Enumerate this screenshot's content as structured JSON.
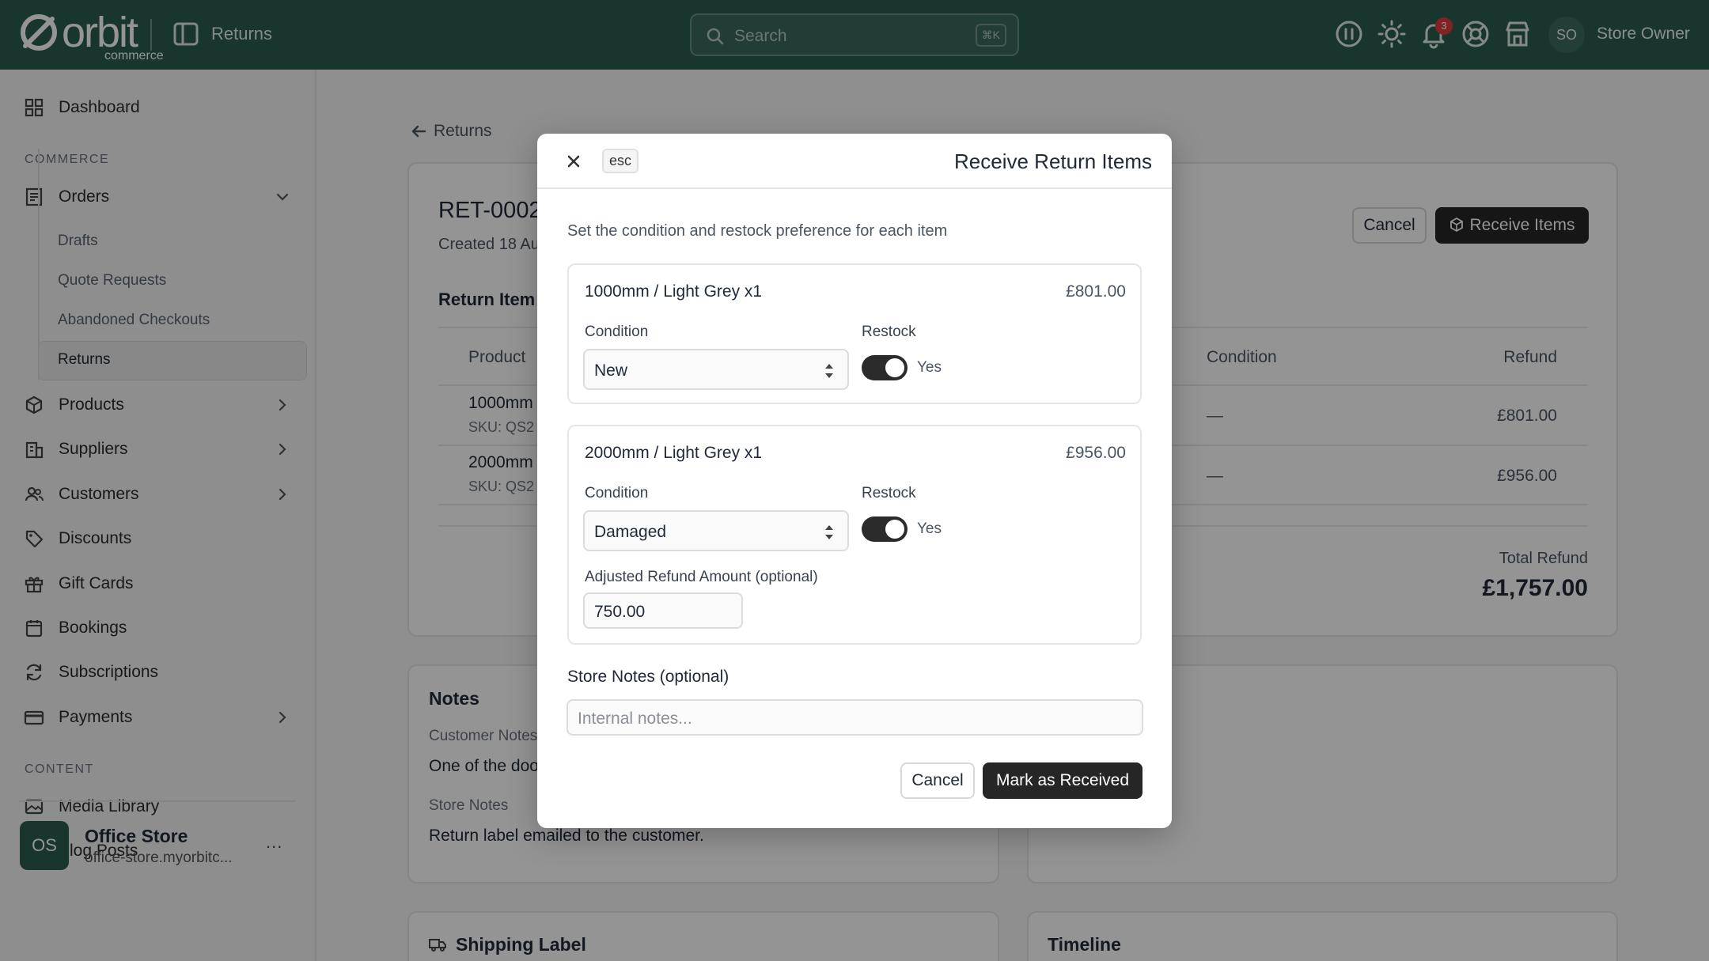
{
  "brand": {
    "name": "orbit",
    "sub": "commerce"
  },
  "header": {
    "page": "Returns",
    "search_placeholder": "Search",
    "search_shortcut": "⌘K",
    "notification_count": "3",
    "user_initials": "SO",
    "user_name": "Store Owner"
  },
  "sidebar": {
    "dashboard": "Dashboard",
    "section_commerce": "COMMERCE",
    "orders": "Orders",
    "orders_sub": [
      "Drafts",
      "Quote Requests",
      "Abandoned Checkouts",
      "Returns"
    ],
    "products": "Products",
    "suppliers": "Suppliers",
    "customers": "Customers",
    "discounts": "Discounts",
    "gift_cards": "Gift Cards",
    "bookings": "Bookings",
    "subscriptions": "Subscriptions",
    "payments": "Payments",
    "section_content": "CONTENT",
    "media_library": "Media Library",
    "blog_posts": "Blog Posts",
    "store": {
      "initials": "OS",
      "name": "Office Store",
      "url": "office-store.myorbitc...",
      "more": "..."
    }
  },
  "page": {
    "back_label": "Returns",
    "return_id": "RET-0002",
    "created": "Created 18 Au",
    "cancel_label": "Cancel",
    "receive_label": "Receive Items",
    "return_items_heading": "Return Item",
    "table": {
      "headers": [
        "Product",
        "Condition",
        "Refund"
      ],
      "rows": [
        {
          "product": "1000mm",
          "sku": "SKU: QS2",
          "condition": "—",
          "refund": "£801.00"
        },
        {
          "product": "2000mm",
          "sku": "SKU: QS2",
          "condition": "—",
          "refund": "£956.00"
        }
      ]
    },
    "total_label": "Total Refund",
    "total_value": "£1,757.00",
    "notes": {
      "title": "Notes",
      "customer_notes_label": "Customer Notes",
      "customer_notes_value": "One of the doo",
      "store_notes_label": "Store Notes",
      "store_notes_value": "Return label emailed to the customer."
    },
    "shipping_label_title": "Shipping Label",
    "timeline_title": "Timeline"
  },
  "modal": {
    "esc_label": "esc",
    "title": "Receive Return Items",
    "description": "Set the condition and restock preference for each item",
    "items": [
      {
        "title": "1000mm / Light Grey x1",
        "price": "£801.00",
        "condition_label": "Condition",
        "condition_value": "New",
        "restock_label": "Restock",
        "restock_value": "Yes"
      },
      {
        "title": "2000mm / Light Grey x1",
        "price": "£956.00",
        "condition_label": "Condition",
        "condition_value": "Damaged",
        "restock_label": "Restock",
        "restock_value": "Yes",
        "adjusted_label": "Adjusted Refund Amount (optional)",
        "adjusted_value": "750.00"
      }
    ],
    "store_notes_label": "Store Notes (optional)",
    "store_notes_placeholder": "Internal notes...",
    "cancel_label": "Cancel",
    "submit_label": "Mark as Received"
  }
}
